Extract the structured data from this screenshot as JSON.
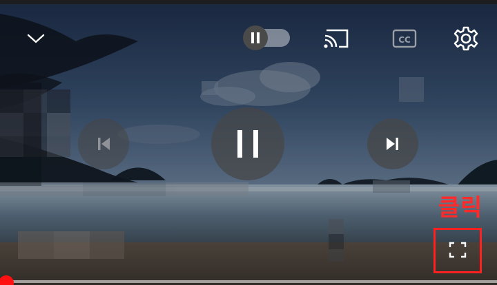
{
  "player": {
    "collapse_icon": "chevron-down-icon",
    "autoplay_toggle": {
      "state": "on",
      "icon": "pause-icon"
    },
    "cast_icon": "cast-icon",
    "captions_icon": "closed-captions-icon",
    "captions_label": "CC",
    "settings_icon": "gear-icon",
    "previous_icon": "skip-previous-icon",
    "play_pause_icon": "pause-icon",
    "next_icon": "skip-next-icon",
    "fullscreen_icon": "fullscreen-icon",
    "progress": {
      "fraction": 0.0
    }
  },
  "annotation": {
    "label": "클릭",
    "color": "#ff2020"
  },
  "colors": {
    "accent": "#ff1111",
    "icon": "#ffffff"
  }
}
